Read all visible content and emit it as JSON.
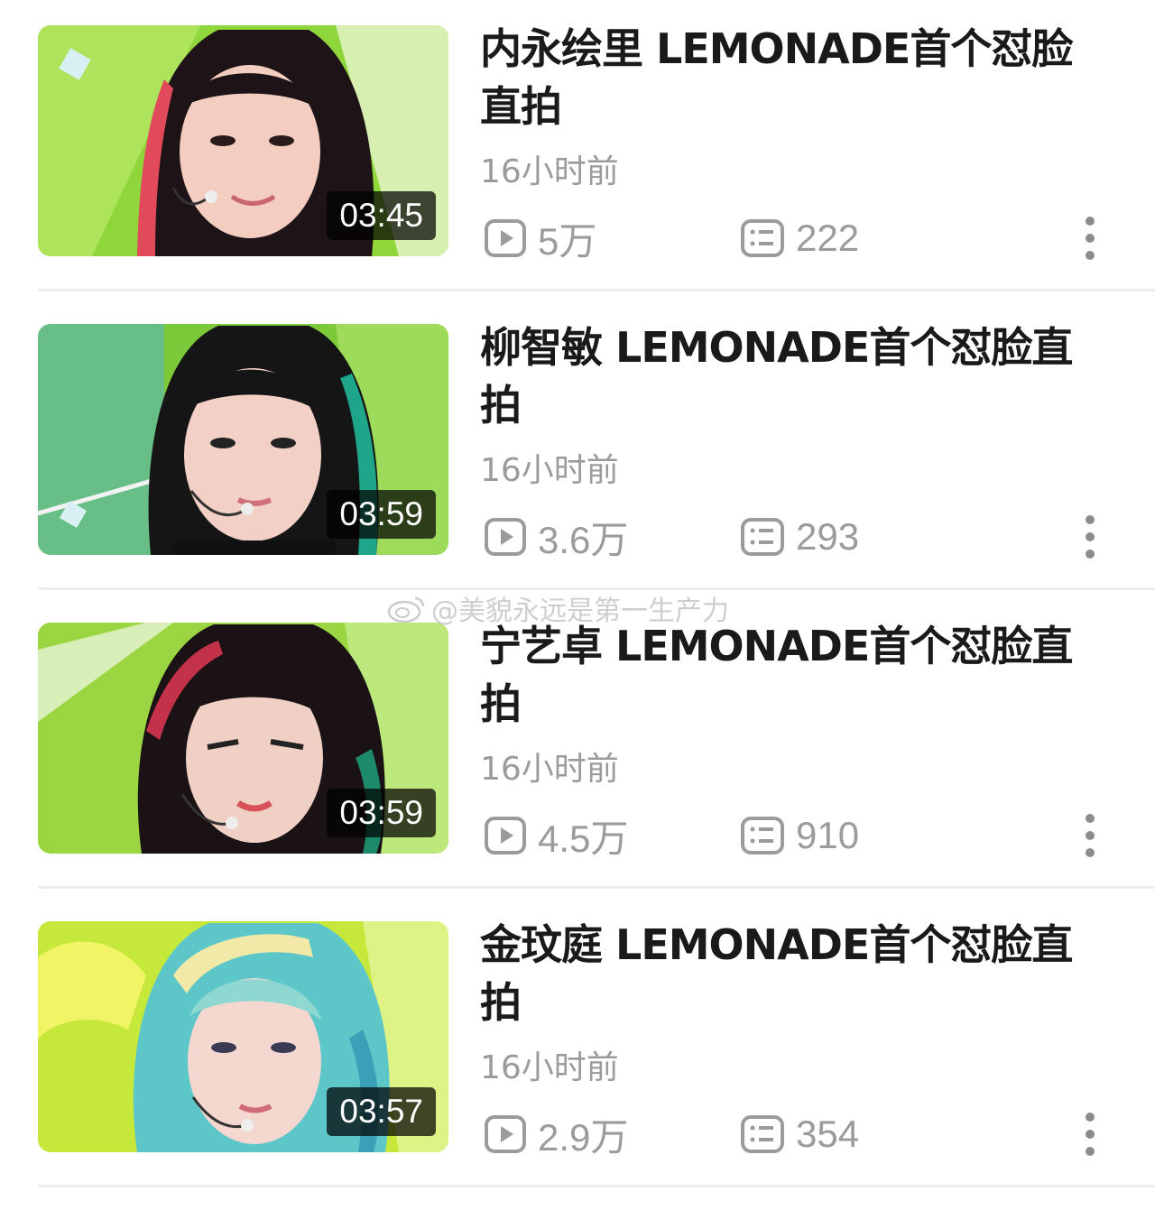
{
  "videos": [
    {
      "title": "内永绘里 LEMONADE首个怼脸直拍",
      "time": "16小时前",
      "views": "5万",
      "comments": "222",
      "duration": "03:45",
      "hair": "#1e1418",
      "streak": "#e14a5a",
      "bg": "#8fd63a"
    },
    {
      "title": "柳智敏 LEMONADE首个怼脸直拍",
      "time": "16小时前",
      "views": "3.6万",
      "comments": "293",
      "duration": "03:59",
      "hair": "#151515",
      "streak": "#1fa58a",
      "bg": "#7cc93a"
    },
    {
      "title": "宁艺卓 LEMONADE首个怼脸直拍",
      "time": "16小时前",
      "views": "4.5万",
      "comments": "910",
      "duration": "03:59",
      "hair": "#1a1214",
      "streak": "#c4324a",
      "bg": "#9bd642"
    },
    {
      "title": "金玟庭 LEMONADE首个怼脸直拍",
      "time": "16小时前",
      "views": "2.9万",
      "comments": "354",
      "duration": "03:57",
      "hair": "#5cc6c9",
      "streak": "#f2e9a8",
      "bg": "#c6e83a"
    }
  ],
  "watermark": "@美貌永远是第一生产力",
  "icons": {
    "views": "play-icon",
    "comments": "comment-icon",
    "more": "more-vertical-icon"
  }
}
